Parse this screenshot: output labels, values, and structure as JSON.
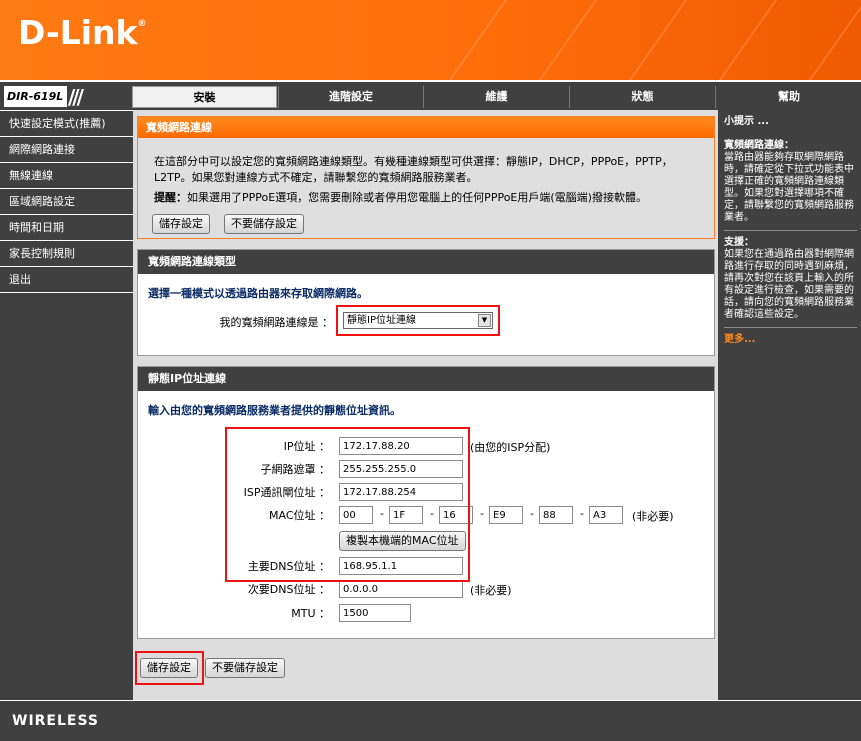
{
  "brand": {
    "logo": "D-Link",
    "reg": "®",
    "model": "DIR-619L",
    "footer": "WIRELESS"
  },
  "nav": {
    "tabs": [
      {
        "label": "安裝",
        "active": true
      },
      {
        "label": "進階設定"
      },
      {
        "label": "維護"
      },
      {
        "label": "狀態"
      },
      {
        "label": "幫助"
      }
    ]
  },
  "sidebar": {
    "items": [
      "快速設定模式(推薦)",
      "網際網路連接",
      "無線連線",
      "區域網路設定",
      "時間和日期",
      "家長控制規則",
      "退出"
    ]
  },
  "section1": {
    "title": "寬頻網路連線",
    "desc": "在這部分中可以設定您的寬頻網路連線類型。有幾種連線類型可供選擇：靜態IP，DHCP，PPPoE，PPTP，L2TP。如果您對連線方式不確定，請聯繫您的寬頻網路服務業者。",
    "note_label": "提醒：",
    "note_text": "如果選用了PPPoE選項，您需要刪除或者停用您電腦上的任何PPPoE用戶端(電腦端)撥接軟體。",
    "save": "儲存設定",
    "nosave": "不要儲存設定"
  },
  "section2": {
    "title": "寬頻網路連線類型",
    "subtitle": "選擇一種模式以透過路由器來存取網際網路。",
    "label": "我的寬頻網路連線是 ：",
    "selected": "靜態IP位址連線"
  },
  "section3": {
    "title": "靜態IP位址連線",
    "subtitle": "輸入由您的寬頻網路服務業者提供的靜態位址資訊。",
    "ip_label": "IP位址 ：",
    "ip_value": "172.17.88.20",
    "ip_note": "(由您的ISP分配)",
    "mask_label": "子網路遮罩 ：",
    "mask_value": "255.255.255.0",
    "gw_label": "ISP通訊閘位址 ：",
    "gw_value": "172.17.88.254",
    "mac_label": "MAC位址 ：",
    "mac": [
      "00",
      "1F",
      "16",
      "E9",
      "88",
      "A3"
    ],
    "mac_sep": "-",
    "mac_note": "(非必要)",
    "clone_mac": "複製本機端的MAC位址",
    "dns1_label": "主要DNS位址 ：",
    "dns1_value": "168.95.1.1",
    "dns2_label": "次要DNS位址 ：",
    "dns2_value": "0.0.0.0",
    "dns2_note": "(非必要)",
    "mtu_label": "MTU ：",
    "mtu_value": "1500"
  },
  "bottom": {
    "save": "儲存設定",
    "nosave": "不要儲存設定"
  },
  "help": {
    "title": "小提示 ...",
    "h1": "寬頻網路連線：",
    "t1": "當路由器能夠存取網際網路時，請確定從下拉式功能表中選擇正確的寬頻網路連線類型。如果您對選擇哪項不確定，請聯繫您的寬頻網路服務業者。",
    "h2": "支援：",
    "t2": "如果您在通過路由器對網際網路進行存取的同時遇到麻煩，請再次對您在該頁上輸入的所有設定進行檢查，如果需要的話，請向您的寬頻網路服務業者確認這些設定。",
    "more": "更多..."
  },
  "colors": {
    "accent": "#ff7a14",
    "dark": "#404040",
    "highlight": "#e11111",
    "subtitle": "#0c2c67"
  }
}
